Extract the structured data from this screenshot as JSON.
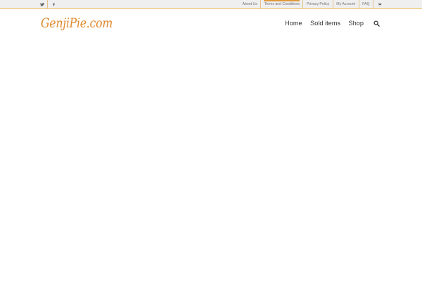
{
  "top_bar": {
    "social": [
      {
        "name": "twitter-icon"
      },
      {
        "name": "facebook-icon"
      }
    ],
    "links": [
      "About Us",
      "Terms and Conditions",
      "Privacy Policy",
      "My Account",
      "FAQ"
    ],
    "active_link": "Terms and Conditions",
    "cart_icon": "cart-icon"
  },
  "header": {
    "logo_text": "GenjiPie.com",
    "nav": [
      "Home",
      "Sold items",
      "Shop"
    ],
    "search_icon": "search-icon"
  },
  "colors": {
    "accent": "#e0983d",
    "logo": "#e08a2e",
    "topbar_bg": "#efefef",
    "nav_text": "#333333"
  }
}
